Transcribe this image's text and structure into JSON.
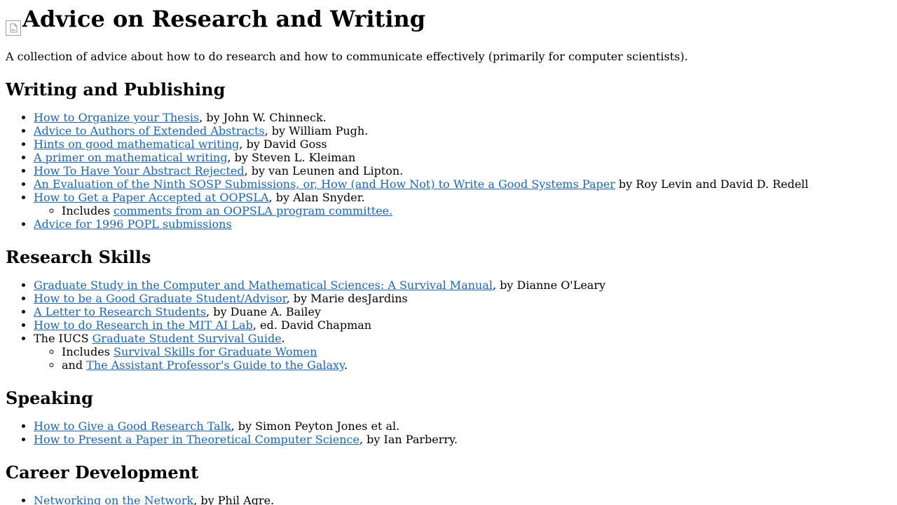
{
  "page": {
    "title": "Advice on Research and Writing",
    "intro": "A collection of advice about how to do research and how to communicate effectively (primarily for computer scientists)."
  },
  "sections": [
    {
      "heading": "Writing and Publishing",
      "items": [
        {
          "link": "How to Organize your Thesis",
          "suffix": ", by John W. Chinneck."
        },
        {
          "link": "Advice to Authors of Extended Abstracts",
          "suffix": ", by William Pugh."
        },
        {
          "link": "Hints on good mathematical writing",
          "suffix": ", by David Goss"
        },
        {
          "link": "A primer on mathematical writing",
          "suffix": ", by Steven L. Kleiman"
        },
        {
          "link": "How To Have Your Abstract Rejected",
          "suffix": ", by van Leunen and Lipton."
        },
        {
          "link": "An Evaluation of the Ninth SOSP Submissions, or, How (and How Not) to Write a Good Systems Paper",
          "suffix": " by Roy Levin and David D. Redell"
        },
        {
          "link": "How to Get a Paper Accepted at OOPSLA",
          "suffix": ", by Alan Snyder.",
          "sub": [
            {
              "prefix": "Includes ",
              "link": "comments from an OOPSLA program committee.",
              "suffix": ""
            }
          ]
        },
        {
          "link": "Advice for 1996 POPL submissions",
          "suffix": ""
        }
      ]
    },
    {
      "heading": "Research Skills",
      "items": [
        {
          "link": "Graduate Study in the Computer and Mathematical Sciences: A Survival Manual",
          "suffix": ", by Dianne O'Leary"
        },
        {
          "link": "How to be a Good Graduate Student/Advisor",
          "suffix": ", by Marie desJardins"
        },
        {
          "link": "A Letter to Research Students",
          "suffix": ", by Duane A. Bailey"
        },
        {
          "link": "How to do Research in the MIT AI Lab",
          "suffix": ", ed. David Chapman"
        },
        {
          "prefix": "The IUCS ",
          "link": "Graduate Student Survival Guide",
          "suffix": ".",
          "sub": [
            {
              "prefix": "Includes ",
              "link": "Survival Skills for Graduate Women",
              "suffix": ""
            },
            {
              "prefix": "and ",
              "link": "The Assistant Professor's Guide to the Galaxy",
              "suffix": "."
            }
          ]
        }
      ]
    },
    {
      "heading": "Speaking",
      "items": [
        {
          "link": "How to Give a Good Research Talk",
          "suffix": ", by Simon Peyton Jones et al."
        },
        {
          "link": "How to Present a Paper in Theoretical Computer Science",
          "suffix": ", by Ian Parberry."
        }
      ]
    },
    {
      "heading": "Career Development",
      "items": [
        {
          "link": "Networking on the Network",
          "suffix": ", by Phil Agre."
        }
      ]
    }
  ],
  "colors": {
    "link": "#1a66b3",
    "text": "#000000",
    "background": "#ffffff"
  },
  "icons": {
    "header_image": "broken-image-icon"
  }
}
